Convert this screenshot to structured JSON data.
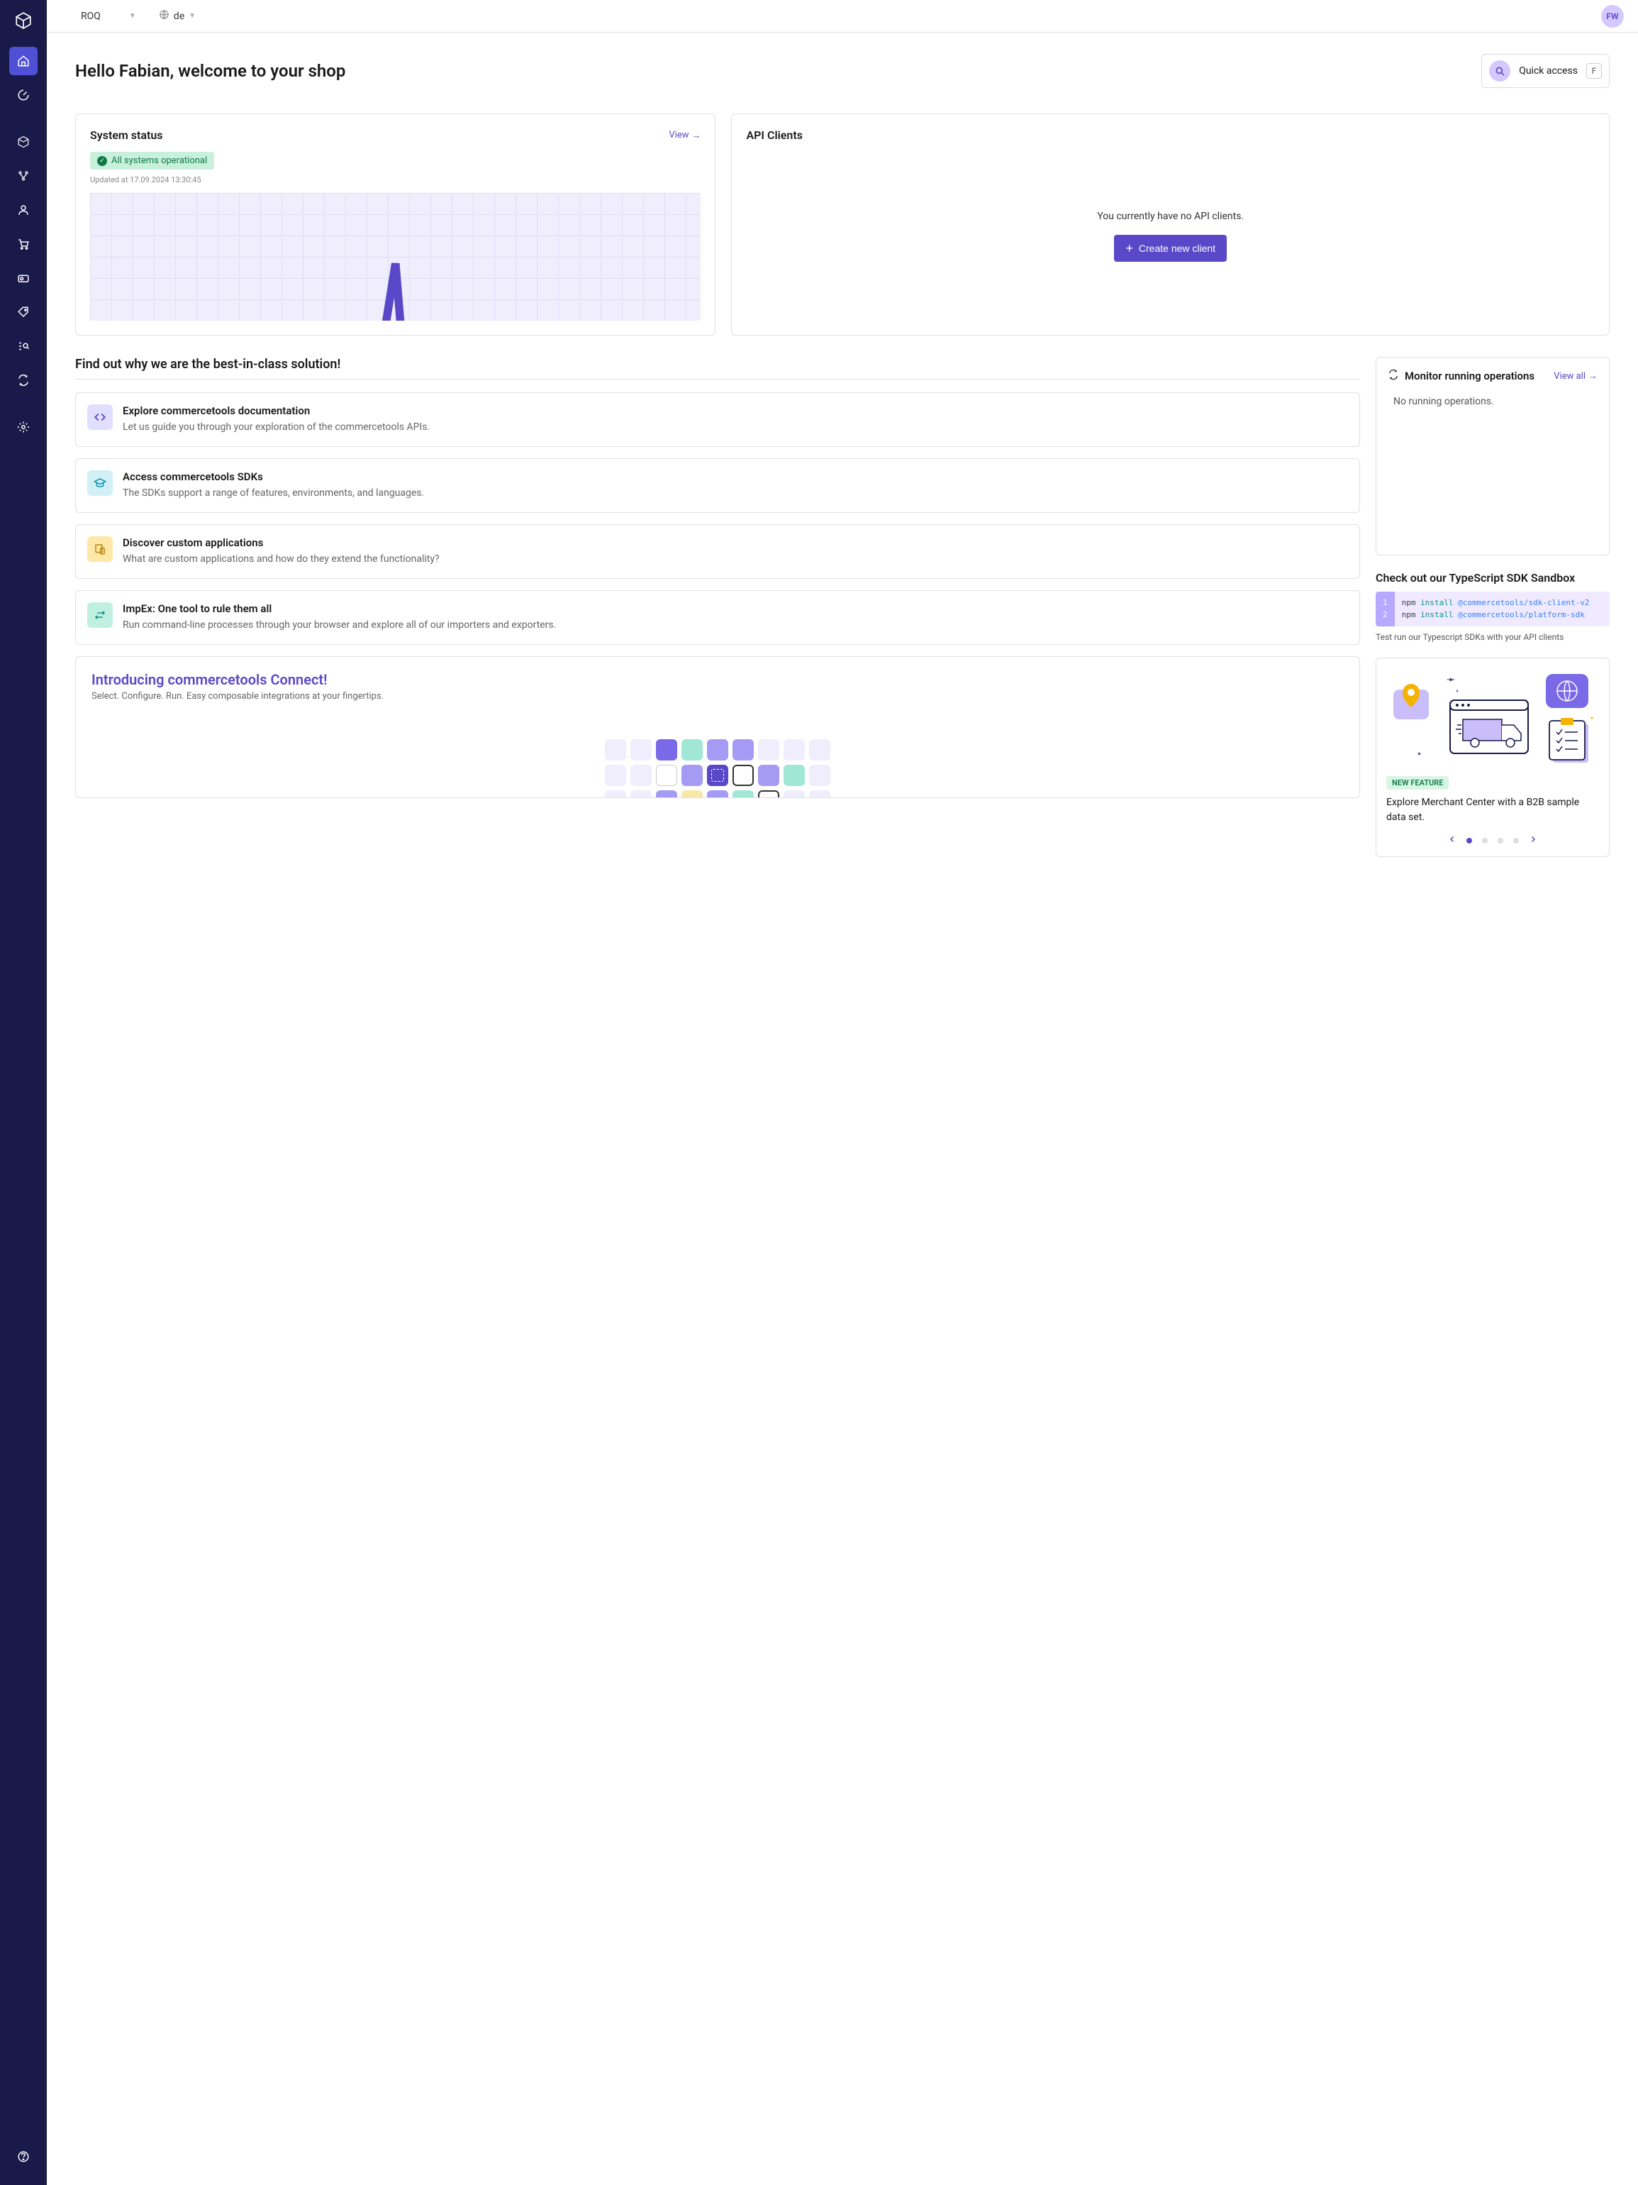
{
  "topbar": {
    "project": "ROQ",
    "lang": "de",
    "avatar": "FW"
  },
  "header": {
    "title": "Hello Fabian, welcome to your shop",
    "quick_access": "Quick access",
    "quick_key": "F"
  },
  "status_card": {
    "title": "System status",
    "view": "View",
    "badge": "All systems operational",
    "updated": "Updated at 17.09.2024 13:30:45"
  },
  "api_card": {
    "title": "API Clients",
    "empty": "You currently have no API clients.",
    "cta": "Create new client"
  },
  "best_title": "Find out why we are the best-in-class solution!",
  "links": [
    {
      "title": "Explore commercetools documentation",
      "desc": "Let us guide you through your exploration of the commercetools APIs."
    },
    {
      "title": "Access commercetools SDKs",
      "desc": "The SDKs support a range of features, environments, and languages."
    },
    {
      "title": "Discover custom applications",
      "desc": "What are custom applications and how do they extend the functionality?"
    },
    {
      "title": "ImpEx: One tool to rule them all",
      "desc": "Run command-line processes through your browser and explore all of our importers and exporters."
    }
  ],
  "connect": {
    "title": "Introducing commercetools Connect!",
    "sub": "Select. Configure. Run. Easy composable integrations at your fingertips."
  },
  "monitor": {
    "title": "Monitor running operations",
    "view_all": "View all",
    "empty": "No running operations."
  },
  "sdk": {
    "title": "Check out our TypeScript SDK Sandbox",
    "line1_cmd": "npm ",
    "line1_kw": "install ",
    "line1_pkg": "@commercetools/sdk-client-v2",
    "line2_cmd": "npm ",
    "line2_kw": "install ",
    "line2_pkg": "@commercetools/platform-sdk",
    "line_no1": "1",
    "line_no2": "2",
    "sub": "Test run our Typescript SDKs with your API clients"
  },
  "feature": {
    "badge": "NEW FEATURE",
    "text": "Explore Merchant Center with a B2B sample data set."
  }
}
